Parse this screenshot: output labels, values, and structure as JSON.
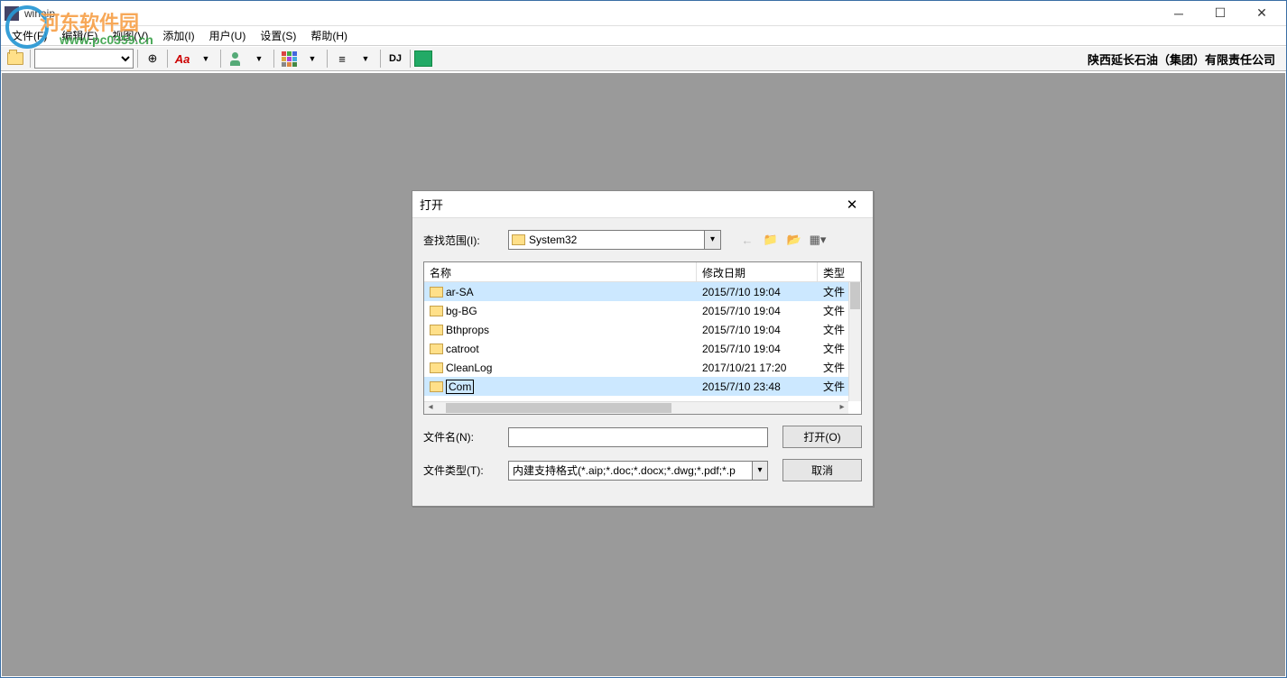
{
  "titlebar": {
    "app_title": "winaip"
  },
  "menubar": {
    "items": [
      "文件(F)",
      "编辑(E)",
      "视图(V)",
      "添加(I)",
      "用户(U)",
      "设置(S)",
      "帮助(H)"
    ]
  },
  "toolbar": {
    "right_text": "陕西延长石油（集团）有限责任公司",
    "dj_label": "DJ"
  },
  "dialog": {
    "title": "打开",
    "look_in_label": "查找范围(I):",
    "look_in_value": "System32",
    "headers": {
      "name": "名称",
      "date": "修改日期",
      "type": "类型"
    },
    "rows": [
      {
        "name": "ar-SA",
        "date": "2015/7/10 19:04",
        "type": "文件",
        "selected": true,
        "editing": false
      },
      {
        "name": "bg-BG",
        "date": "2015/7/10 19:04",
        "type": "文件",
        "selected": false,
        "editing": false
      },
      {
        "name": "Bthprops",
        "date": "2015/7/10 19:04",
        "type": "文件",
        "selected": false,
        "editing": false
      },
      {
        "name": "catroot",
        "date": "2015/7/10 19:04",
        "type": "文件",
        "selected": false,
        "editing": false
      },
      {
        "name": "CleanLog",
        "date": "2017/10/21 17:20",
        "type": "文件",
        "selected": false,
        "editing": false
      },
      {
        "name": "Com",
        "date": "2015/7/10 23:48",
        "type": "文件",
        "selected": true,
        "editing": true
      }
    ],
    "filename_label": "文件名(N):",
    "filename_value": "",
    "filetype_label": "文件类型(T):",
    "filetype_value": "内建支持格式(*.aip;*.doc;*.docx;*.dwg;*.pdf;*.p",
    "open_btn": "打开(O)",
    "cancel_btn": "取消"
  },
  "watermark": {
    "text": "河东软件园",
    "url": "www.pc0359.cn"
  }
}
